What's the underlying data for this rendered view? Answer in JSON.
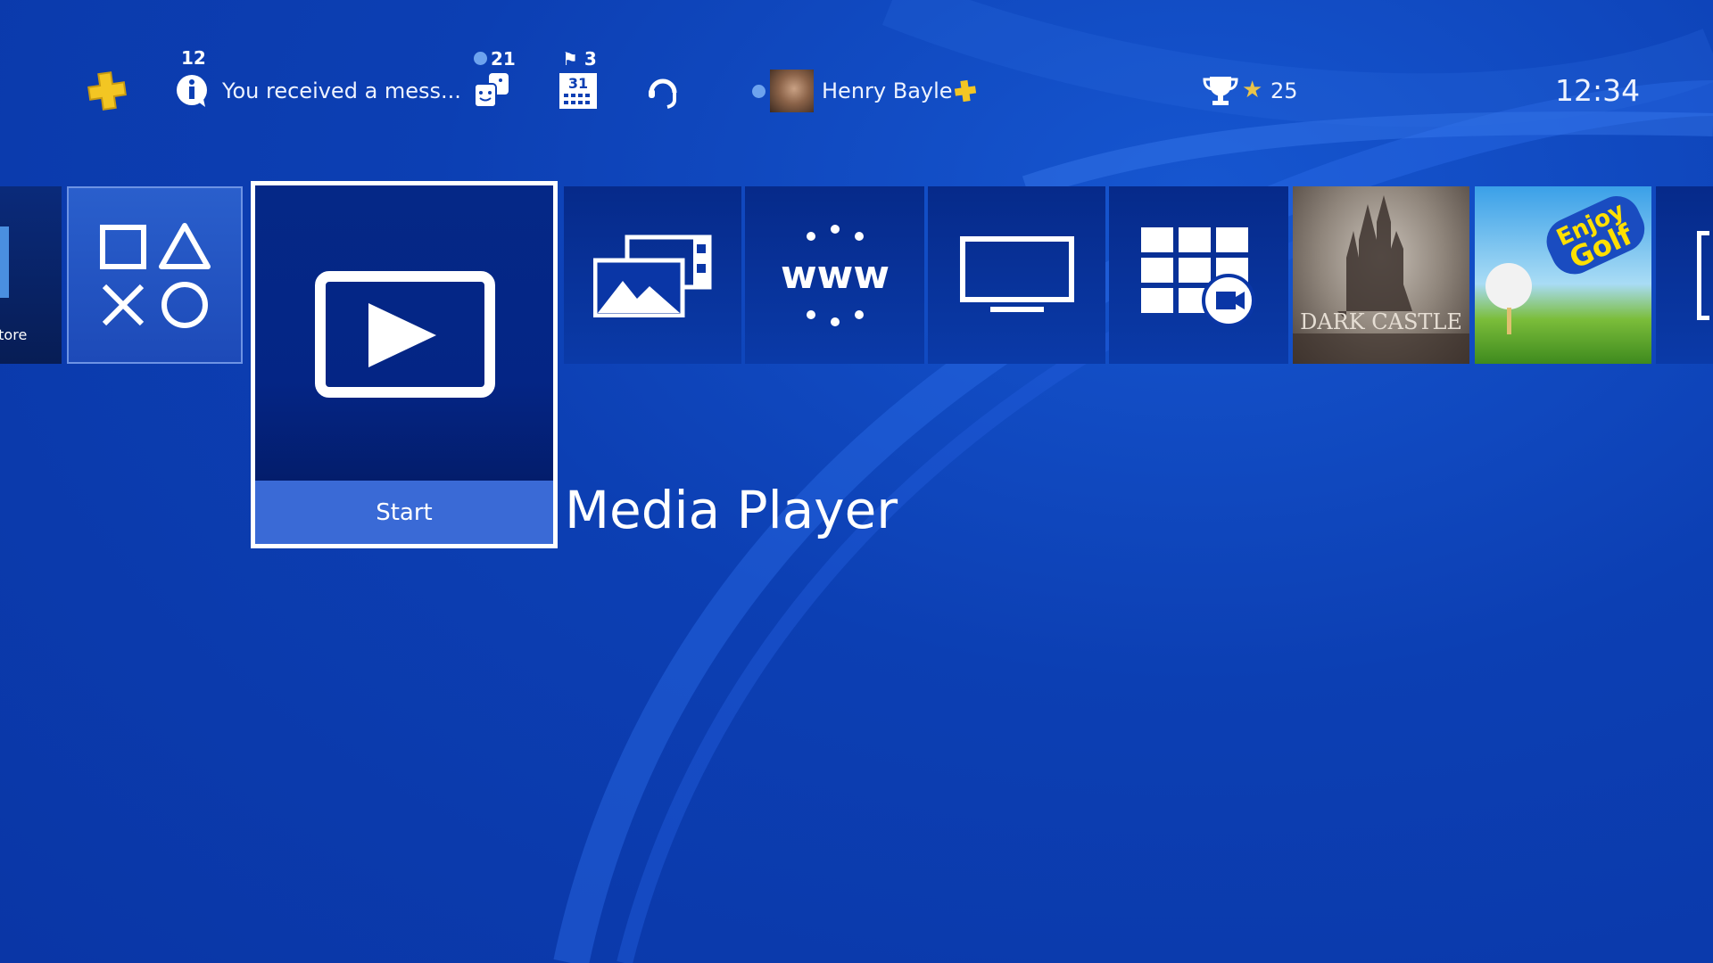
{
  "topbar": {
    "notification_count": "12",
    "notification_text": "You received a mess...",
    "friends_count": "21",
    "events_count": "3",
    "user_name": "Henry Bayle",
    "trophy_count": "25",
    "clock": "12:34"
  },
  "tiles": [
    {
      "name": "PlayStation Store",
      "label": "Store",
      "icon": "store-bag-icon"
    },
    {
      "name": "Library",
      "icon": "ps-shapes-icon"
    },
    {
      "name": "Media Player",
      "icon": "play-icon",
      "selected": true,
      "action": "Start"
    },
    {
      "name": "Capture Gallery",
      "icon": "gallery-icon"
    },
    {
      "name": "Internet Browser",
      "icon": "www-icon"
    },
    {
      "name": "TV & Video",
      "icon": "tv-icon"
    },
    {
      "name": "Share",
      "icon": "windows-camera-icon"
    },
    {
      "name": "Dark Castle",
      "art_text": "DARK CASTLE"
    },
    {
      "name": "Enjoy Golf",
      "art_text": "Enjoy Golf"
    },
    {
      "name": "Next item",
      "icon": "partial-icon"
    }
  ],
  "selected": {
    "title": "Media Player",
    "action": "Start"
  },
  "colors": {
    "background": "#0c3fb3",
    "tile": "#062a8a",
    "selected_border": "#ffffff",
    "start_bar": "#3a6ad6",
    "plus_gold": "#f3c623"
  }
}
